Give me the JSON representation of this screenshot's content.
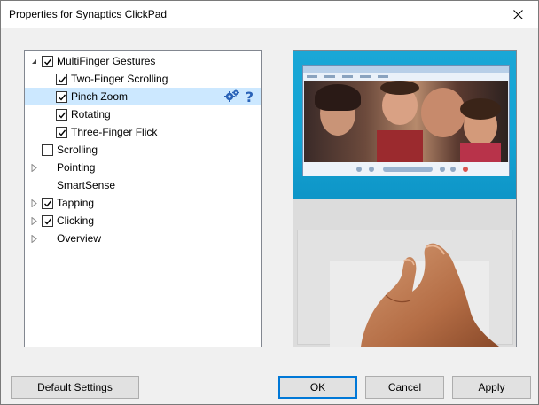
{
  "window": {
    "title": "Properties for Synaptics ClickPad",
    "close_glyph": "×"
  },
  "tree": {
    "items": [
      {
        "label": "MultiFinger Gestures",
        "checked": true,
        "expander": "expanded",
        "level": 0
      },
      {
        "label": "Two-Finger Scrolling",
        "checked": true,
        "expander": "none",
        "level": 1
      },
      {
        "label": "Pinch Zoom",
        "checked": true,
        "expander": "none",
        "level": 1,
        "selected": true
      },
      {
        "label": "Rotating",
        "checked": true,
        "expander": "none",
        "level": 1
      },
      {
        "label": "Three-Finger Flick",
        "checked": true,
        "expander": "none",
        "level": 1
      },
      {
        "label": "Scrolling",
        "checked": false,
        "expander": "none",
        "level": 0
      },
      {
        "label": "Pointing",
        "checked": null,
        "expander": "collapsed",
        "level": 0
      },
      {
        "label": "SmartSense",
        "checked": null,
        "expander": "none",
        "level": 0
      },
      {
        "label": "Tapping",
        "checked": true,
        "expander": "collapsed",
        "level": 0
      },
      {
        "label": "Clicking",
        "checked": true,
        "expander": "collapsed",
        "level": 0
      },
      {
        "label": "Overview",
        "checked": null,
        "expander": "collapsed",
        "level": 0
      }
    ],
    "selected_tools": {
      "settings_icon": "gears-icon",
      "help_glyph": "?"
    }
  },
  "buttons": {
    "default_settings": "Default Settings",
    "ok": "OK",
    "cancel": "Cancel",
    "apply": "Apply"
  },
  "colors": {
    "selection": "#cce8ff",
    "accent": "#0078d7",
    "help": "#2a63b8"
  }
}
